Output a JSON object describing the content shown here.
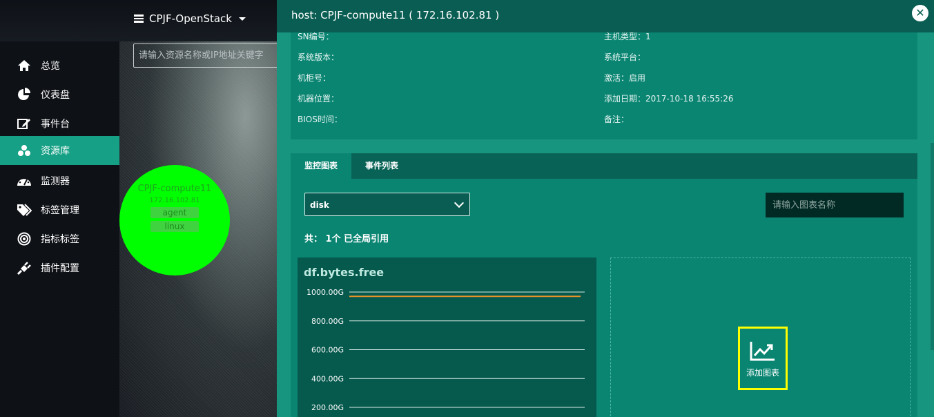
{
  "topbar": {
    "cluster": "CPJF-OpenStack"
  },
  "sidebar": {
    "items": [
      {
        "label": "总览",
        "icon": "home-icon"
      },
      {
        "label": "仪表盘",
        "icon": "pie-chart-icon"
      },
      {
        "label": "事件台",
        "icon": "edit-icon"
      },
      {
        "label": "资源库",
        "icon": "cubes-icon",
        "active": true
      },
      {
        "label": "监测器",
        "icon": "dashboard-icon"
      },
      {
        "label": "标签管理",
        "icon": "tags-icon"
      },
      {
        "label": "指标标签",
        "icon": "target-icon"
      },
      {
        "label": "插件配置",
        "icon": "plug-icon"
      }
    ]
  },
  "topology": {
    "search_placeholder": "请输入资源名称或IP地址关键字",
    "node": {
      "name": "CPJF-compute11",
      "ip": "172.16.102.81",
      "tags": [
        "agent",
        "linux"
      ],
      "color": "#00ff00"
    }
  },
  "panel": {
    "title": "host: CPJF-compute11 ( 172.16.102.81 )",
    "info": {
      "left": [
        {
          "label": "SN编号：",
          "value": ""
        },
        {
          "label": "系统版本：",
          "value": ""
        },
        {
          "label": "机柜号：",
          "value": ""
        },
        {
          "label": "机器位置：",
          "value": ""
        },
        {
          "label": "BIOS时间：",
          "value": ""
        }
      ],
      "right": [
        {
          "label": "主机类型：",
          "value": "1"
        },
        {
          "label": "系统平台：",
          "value": ""
        },
        {
          "label": "激活：",
          "value": "启用"
        },
        {
          "label": "添加日期：",
          "value": "2017-10-18 16:55:26"
        },
        {
          "label": "备注：",
          "value": ""
        }
      ]
    },
    "tabs": [
      {
        "label": "监控图表",
        "active": true
      },
      {
        "label": "事件列表"
      }
    ],
    "select_value": "disk",
    "chart_search_placeholder": "请输入图表名称",
    "count_text": "共： 1个 已全局引用",
    "add_chart_label": "添加图表"
  },
  "chart_data": {
    "type": "line",
    "title": "df.bytes.free",
    "y_ticks": [
      "1000.00G",
      "800.00G",
      "600.00G",
      "400.00G",
      "200.00G"
    ],
    "ylim": [
      200,
      1000
    ],
    "series": [
      {
        "values": [
          970,
          970
        ],
        "color": "#e8932a"
      }
    ]
  }
}
